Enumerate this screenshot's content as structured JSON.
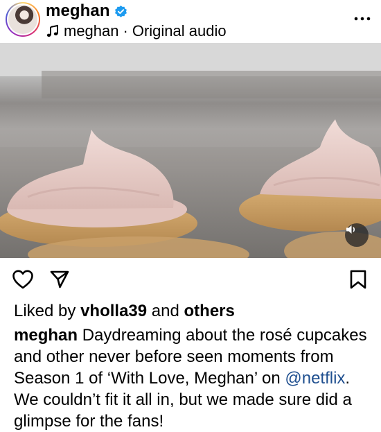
{
  "header": {
    "username": "meghan",
    "audio_owner": "meghan",
    "audio_separator": "·",
    "audio_title": "Original audio"
  },
  "icons": {
    "verified": "verified-badge-icon",
    "music": "music-note-icon",
    "more": "more-options-icon",
    "mute": "speaker-icon",
    "like": "heart-icon",
    "share": "paper-plane-icon",
    "save": "bookmark-icon"
  },
  "likes": {
    "prefix": "Liked by",
    "user": "vholla39",
    "connector": "and",
    "others": "others"
  },
  "caption": {
    "username": "meghan",
    "text_part1": "Daydreaming about the rosé cupcakes and other never before seen moments from Season 1 of ‘With Love, Meghan’ on",
    "mention": "@netflix",
    "text_part2": ". We couldn’t fit it all in, but we made sure did a glimpse for the fans!"
  },
  "colors": {
    "verified": "#1d9bf0",
    "mention": "#1f4f8f",
    "frosting": "#e9cfca",
    "cookie": "#c79c62"
  }
}
